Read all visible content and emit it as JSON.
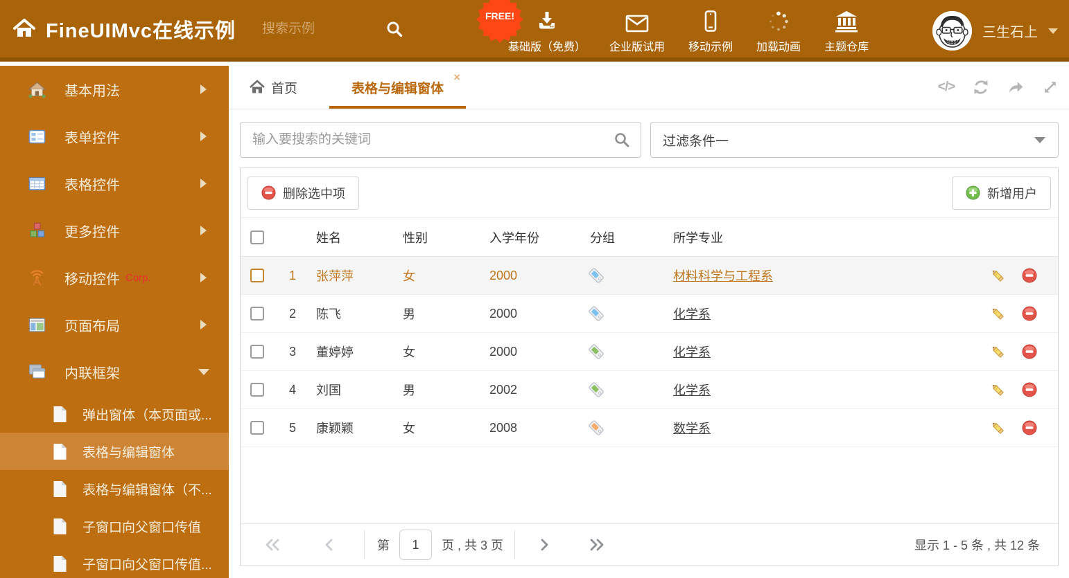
{
  "title": "FineUIMvc在线示例",
  "header": {
    "search_placeholder": "搜索示例",
    "free_badge": "FREE!",
    "nav": [
      {
        "label": "基础版（免费）",
        "icon": "download-icon"
      },
      {
        "label": "企业版试用",
        "icon": "envelope-icon"
      },
      {
        "label": "移动示例",
        "icon": "mobile-icon"
      },
      {
        "label": "加载动画",
        "icon": "spinner-icon"
      },
      {
        "label": "主题仓库",
        "icon": "bank-icon"
      }
    ],
    "user_name": "三生石上"
  },
  "sidebar": {
    "items": [
      {
        "label": "基本用法"
      },
      {
        "label": "表单控件"
      },
      {
        "label": "表格控件"
      },
      {
        "label": "更多控件"
      },
      {
        "label": "移动控件",
        "badge": "Corp."
      },
      {
        "label": "页面布局"
      },
      {
        "label": "内联框架",
        "expanded": true
      }
    ],
    "subitems": [
      {
        "label": "弹出窗体（本页面或..."
      },
      {
        "label": "表格与编辑窗体",
        "selected": true
      },
      {
        "label": "表格与编辑窗体（不..."
      },
      {
        "label": "子窗口向父窗口传值"
      },
      {
        "label": "子窗口向父窗口传值..."
      }
    ]
  },
  "tabs": {
    "home": "首页",
    "active": "表格与编辑窗体",
    "close_glyph": "×"
  },
  "filters": {
    "keyword_placeholder": "输入要搜索的关键词",
    "filter_selected": "过滤条件一"
  },
  "toolbar": {
    "delete_selected": "删除选中项",
    "add_user": "新增用户"
  },
  "grid": {
    "columns": {
      "name": "姓名",
      "gender": "性别",
      "year": "入学年份",
      "group": "分组",
      "major": "所学专业"
    },
    "tag_colors": {
      "blue": "#7dc2ee",
      "green": "#8abf60",
      "orange": "#f6ad69"
    },
    "rows": [
      {
        "index": "1",
        "name": "张萍萍",
        "gender": "女",
        "year": "2000",
        "tag": "blue",
        "major": "材料科学与工程系",
        "highlighted": true
      },
      {
        "index": "2",
        "name": "陈飞",
        "gender": "男",
        "year": "2000",
        "tag": "blue",
        "major": "化学系"
      },
      {
        "index": "3",
        "name": "董婷婷",
        "gender": "女",
        "year": "2000",
        "tag": "green",
        "major": "化学系"
      },
      {
        "index": "4",
        "name": "刘国",
        "gender": "男",
        "year": "2002",
        "tag": "green",
        "major": "化学系"
      },
      {
        "index": "5",
        "name": "康颖颖",
        "gender": "女",
        "year": "2008",
        "tag": "orange",
        "major": "数学系"
      }
    ]
  },
  "pagination": {
    "page_prefix": "第",
    "page_value": "1",
    "page_suffix": "页 , 共 3 页",
    "summary": "显示 1 - 5 条 , 共 12 条"
  },
  "colors": {
    "header_bg": "#a96309",
    "header_border": "#8f5406",
    "sidebar_bg": "#bc6e10",
    "sidebar_selected_bg": "#cd8435",
    "accent": "#b9690e",
    "free_badge": "#ff4713",
    "corp_badge": "#e83030",
    "delete_red": "#e25449",
    "add_green": "#74bd4d"
  }
}
